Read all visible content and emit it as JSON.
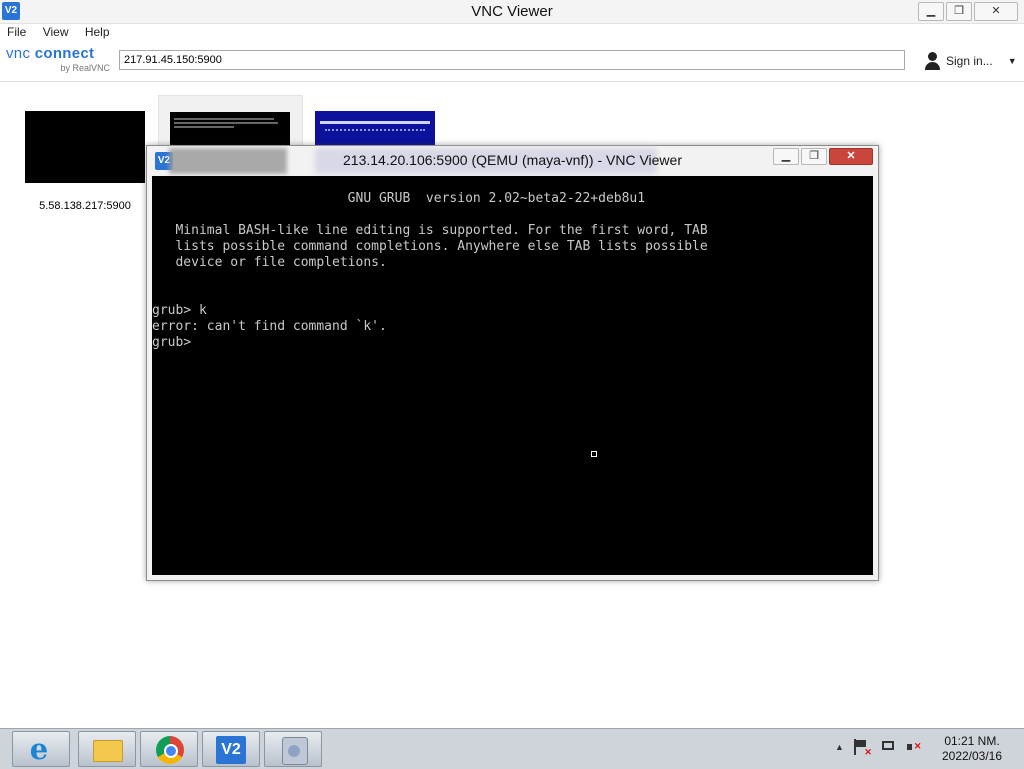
{
  "window": {
    "title": "VNC Viewer",
    "minimize": "▁",
    "restore": "❐",
    "close": "✕"
  },
  "menu": [
    "File",
    "View",
    "Help"
  ],
  "toolbar": {
    "logo_vnc": "vnc",
    "logo_connect": "connect",
    "logo_by": "by RealVNC",
    "address_value": "217.91.45.150:5900",
    "signin_label": "Sign in...",
    "signin_caret": "▼"
  },
  "thumbnails": [
    {
      "label": "5.58.138.217:5900"
    }
  ],
  "viewer": {
    "title": "213.14.20.106:5900 (QEMU (maya-vnf)) - VNC Viewer",
    "close": "✕",
    "console_lines": [
      "                         GNU GRUB  version 2.02~beta2-22+deb8u1",
      "",
      "   Minimal BASH-like line editing is supported. For the first word, TAB",
      "   lists possible command completions. Anywhere else TAB lists possible",
      "   device or file completions.",
      "",
      "",
      "grub> k",
      "error: can't find command `k'.",
      "grub>"
    ]
  },
  "taskbar": {
    "apps": [
      "ie-icon",
      "file-explorer-icon",
      "chrome-icon",
      "vnc-viewer-icon",
      "setup-icon"
    ],
    "tray_arrow": "▲",
    "clock_time": "01:21 NM.",
    "clock_date": "2022/03/16"
  },
  "colors": {
    "accent": "#2a74d6",
    "console_bg": "#000000",
    "console_fg": "#c8c8c8",
    "close_red": "#c9463d"
  }
}
